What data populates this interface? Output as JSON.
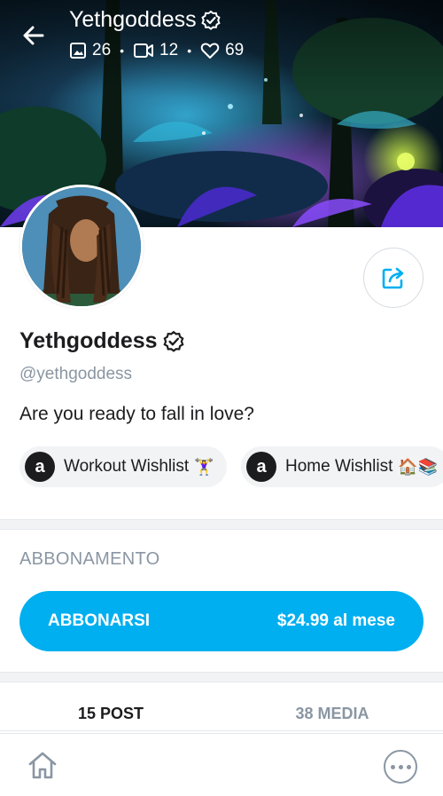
{
  "header": {
    "title": "Yethgoddess",
    "stats": {
      "photos": "26",
      "videos": "12",
      "likes": "69"
    }
  },
  "profile": {
    "name": "Yethgoddess",
    "handle": "@yethgoddess",
    "bio": "Are you ready to fall in love?",
    "links": [
      {
        "label": "Workout Wishlist",
        "emoji": "🏋️‍♀️"
      },
      {
        "label": "Home Wishlist",
        "emoji": "🏠📚"
      }
    ]
  },
  "subscription": {
    "section_title": "ABBONAMENTO",
    "button_label": "ABBONARSI",
    "price": "$24.99 al mese"
  },
  "tabs": [
    {
      "label": "15 POST",
      "active": true
    },
    {
      "label": "38 MEDIA",
      "active": false
    }
  ],
  "colors": {
    "accent": "#00aff0",
    "muted": "#8a96a3"
  }
}
